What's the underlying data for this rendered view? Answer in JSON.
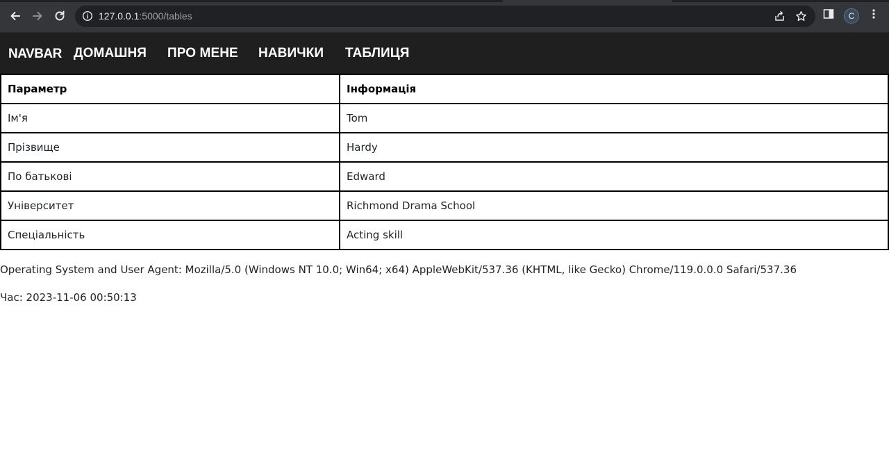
{
  "browser": {
    "url_host": "127.0.0.1",
    "url_path": ":5000/tables",
    "profile_initial": "C"
  },
  "navbar": {
    "brand": "NAVBAR",
    "links": [
      "ДОМАШНЯ",
      "ПРО МЕНЕ",
      "НАВИЧКИ",
      "ТАБЛИЦЯ"
    ]
  },
  "table": {
    "headers": [
      "Параметр",
      "Інформація"
    ],
    "rows": [
      [
        "Ім'я",
        "Tom"
      ],
      [
        "Прізвище",
        "Hardy"
      ],
      [
        "По батькові",
        "Edward"
      ],
      [
        "Університет",
        "Richmond Drama School"
      ],
      [
        "Спеціальність",
        "Acting skill"
      ]
    ]
  },
  "footer": {
    "user_agent": "Operating System and User Agent: Mozilla/5.0 (Windows NT 10.0; Win64; x64) AppleWebKit/537.36 (KHTML, like Gecko) Chrome/119.0.0.0 Safari/537.36",
    "time": "Час: 2023-11-06 00:50:13"
  }
}
